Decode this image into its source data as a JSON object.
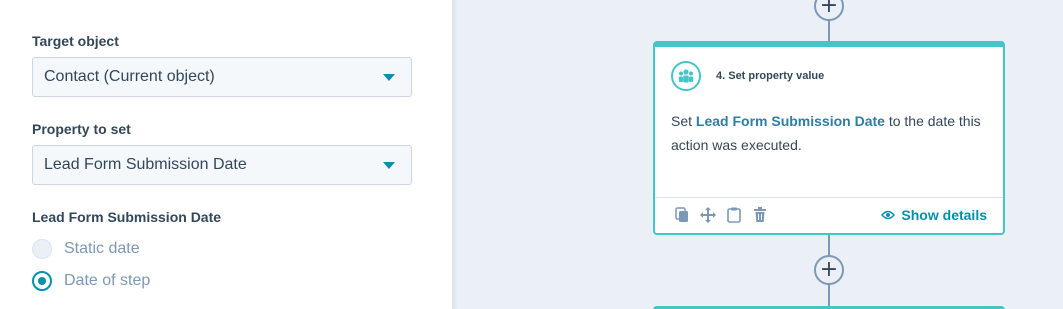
{
  "panel": {
    "target_object": {
      "label": "Target object",
      "value": "Contact (Current object)"
    },
    "property_to_set": {
      "label": "Property to set",
      "value": "Lead Form Submission Date"
    },
    "date_field": {
      "label": "Lead Form Submission Date",
      "options": [
        {
          "label": "Static date",
          "selected": false
        },
        {
          "label": "Date of step",
          "selected": true
        }
      ]
    }
  },
  "workflow": {
    "add_step_symbol": "+",
    "card": {
      "title": "4. Set property value",
      "body_prefix": "Set",
      "body_property": "Lead Form Submission Date",
      "body_suffix": "to the date this action was executed.",
      "show_details_label": "Show details",
      "icons": [
        "copy-icon",
        "move-icon",
        "clipboard-icon",
        "trash-icon",
        "eye-icon",
        "people-icon"
      ]
    },
    "colors": {
      "accent": "#45c5c7",
      "link": "#0091ae",
      "canvas_bg": "#eaf0f6"
    }
  }
}
